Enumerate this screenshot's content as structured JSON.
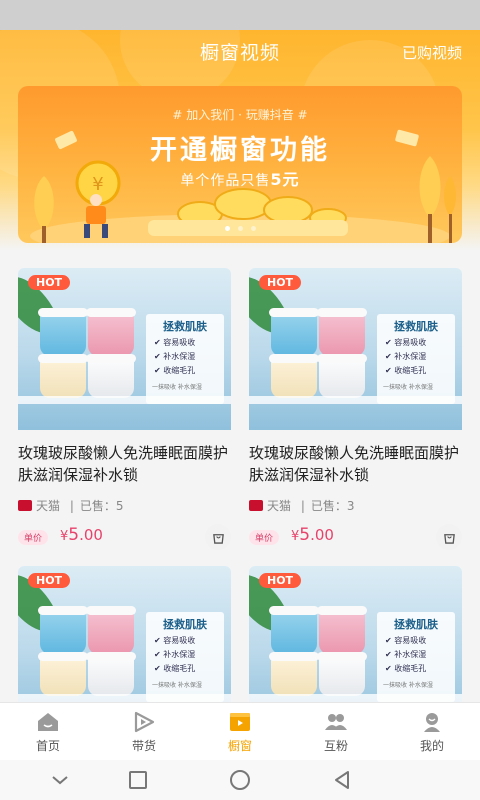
{
  "header": {
    "title": "橱窗视频",
    "bought_link": "已购视频"
  },
  "banner": {
    "top_text": "# 加入我们 · 玩赚抖音 #",
    "main_text": "开通橱窗功能",
    "sub_text_prefix": "单个作品只售",
    "sub_text_amount": "5元",
    "active_dot": 0
  },
  "products": [
    {
      "hot": "HOT",
      "title": "玫瑰玻尿酸懒人免洗睡眠面膜护肤滋润保湿补水锁",
      "shop": "天猫",
      "sales_label": "已售",
      "sales": "5",
      "price_tag": "单价",
      "currency": "¥",
      "price_int": "5",
      "price_dec": ".00",
      "image_heading": "拯救肌肤",
      "image_lines": [
        "✔ 容易吸收",
        "✔ 补水保湿",
        "✔ 收缩毛孔"
      ],
      "image_footer": "一抹吸收 补水保湿"
    },
    {
      "hot": "HOT",
      "title": "玫瑰玻尿酸懒人免洗睡眠面膜护肤滋润保湿补水锁",
      "shop": "天猫",
      "sales_label": "已售",
      "sales": "3",
      "price_tag": "单价",
      "currency": "¥",
      "price_int": "5",
      "price_dec": ".00",
      "image_heading": "拯救肌肤",
      "image_lines": [
        "✔ 容易吸收",
        "✔ 补水保湿",
        "✔ 收缩毛孔"
      ],
      "image_footer": "一抹吸收 补水保湿"
    },
    {
      "hot": "HOT",
      "image_heading": "拯救肌肤",
      "image_lines": [
        "✔ 容易吸收",
        "✔ 补水保湿",
        "✔ 收缩毛孔"
      ],
      "image_footer": "一抹吸收 补水保湿"
    },
    {
      "hot": "HOT",
      "image_heading": "拯救肌肤",
      "image_lines": [
        "✔ 容易吸收",
        "✔ 补水保湿",
        "✔ 收缩毛孔"
      ],
      "image_footer": "一抹吸收 补水保湿"
    }
  ],
  "tabbar": {
    "items": [
      {
        "label": "首页",
        "icon": "home-icon"
      },
      {
        "label": "带货",
        "icon": "play-icon"
      },
      {
        "label": "橱窗",
        "icon": "video-shop-icon"
      },
      {
        "label": "互粉",
        "icon": "friends-icon"
      },
      {
        "label": "我的",
        "icon": "profile-icon"
      }
    ],
    "active_index": 2,
    "active_color": "#f5a300",
    "inactive_color": "#9a9a9a"
  },
  "system_nav": {
    "icons": [
      "chevron-down-icon",
      "square-icon",
      "circle-icon",
      "back-triangle-icon"
    ]
  },
  "colors": {
    "accent": "#ffb52e",
    "price": "#e8426b",
    "hot_badge": "#ff5a3c"
  }
}
